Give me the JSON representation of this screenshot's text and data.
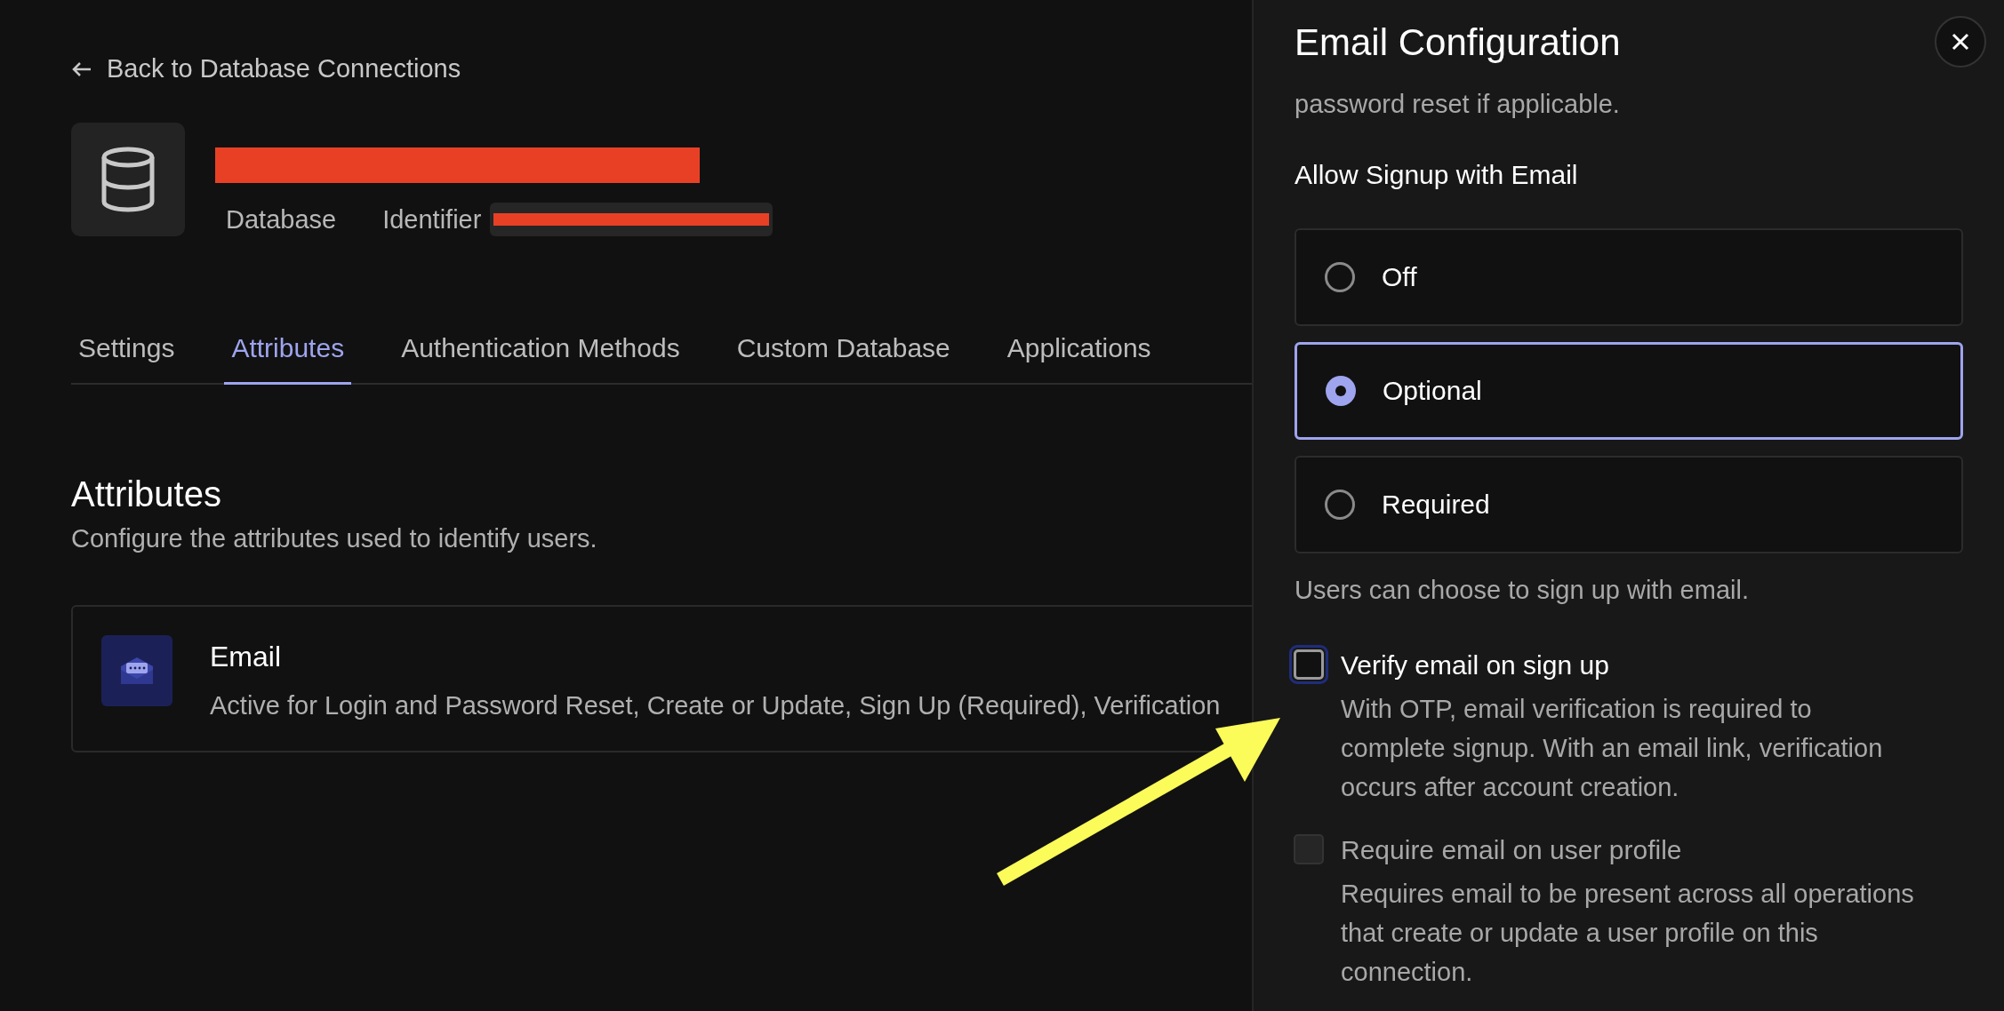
{
  "back_link": {
    "label": "Back to Database Connections"
  },
  "connection": {
    "type_label": "Database",
    "identifier_label": "Identifier",
    "name_redacted": true,
    "identifier_redacted": true
  },
  "tabs": [
    {
      "label": "Settings",
      "selected": false
    },
    {
      "label": "Attributes",
      "selected": true
    },
    {
      "label": "Authentication Methods",
      "selected": false
    },
    {
      "label": "Custom Database",
      "selected": false
    },
    {
      "label": "Applications",
      "selected": false
    }
  ],
  "section": {
    "title": "Attributes",
    "subtitle": "Configure the attributes used to identify users."
  },
  "attributes": [
    {
      "name": "Email",
      "description": "Active for Login and Password Reset, Create or Update, Sign Up (Required), Verification"
    }
  ],
  "panel": {
    "title": "Email Configuration",
    "intro_tail": "password reset if applicable.",
    "signup_label": "Allow Signup with Email",
    "signup_options": [
      {
        "label": "Off",
        "selected": false
      },
      {
        "label": "Optional",
        "selected": true
      },
      {
        "label": "Required",
        "selected": false
      }
    ],
    "signup_help": "Users can choose to sign up with email.",
    "checkboxes": [
      {
        "label": "Verify email on sign up",
        "description": "With OTP, email verification is required to complete signup. With an email link, verification occurs after account creation.",
        "checked": false,
        "disabled": false,
        "focused": true
      },
      {
        "label": "Require email on user profile",
        "description": "Requires email to be present across all operations that create or update a user profile on this connection.",
        "checked": false,
        "disabled": true,
        "focused": false
      }
    ]
  },
  "annotation": {
    "arrow": true
  }
}
